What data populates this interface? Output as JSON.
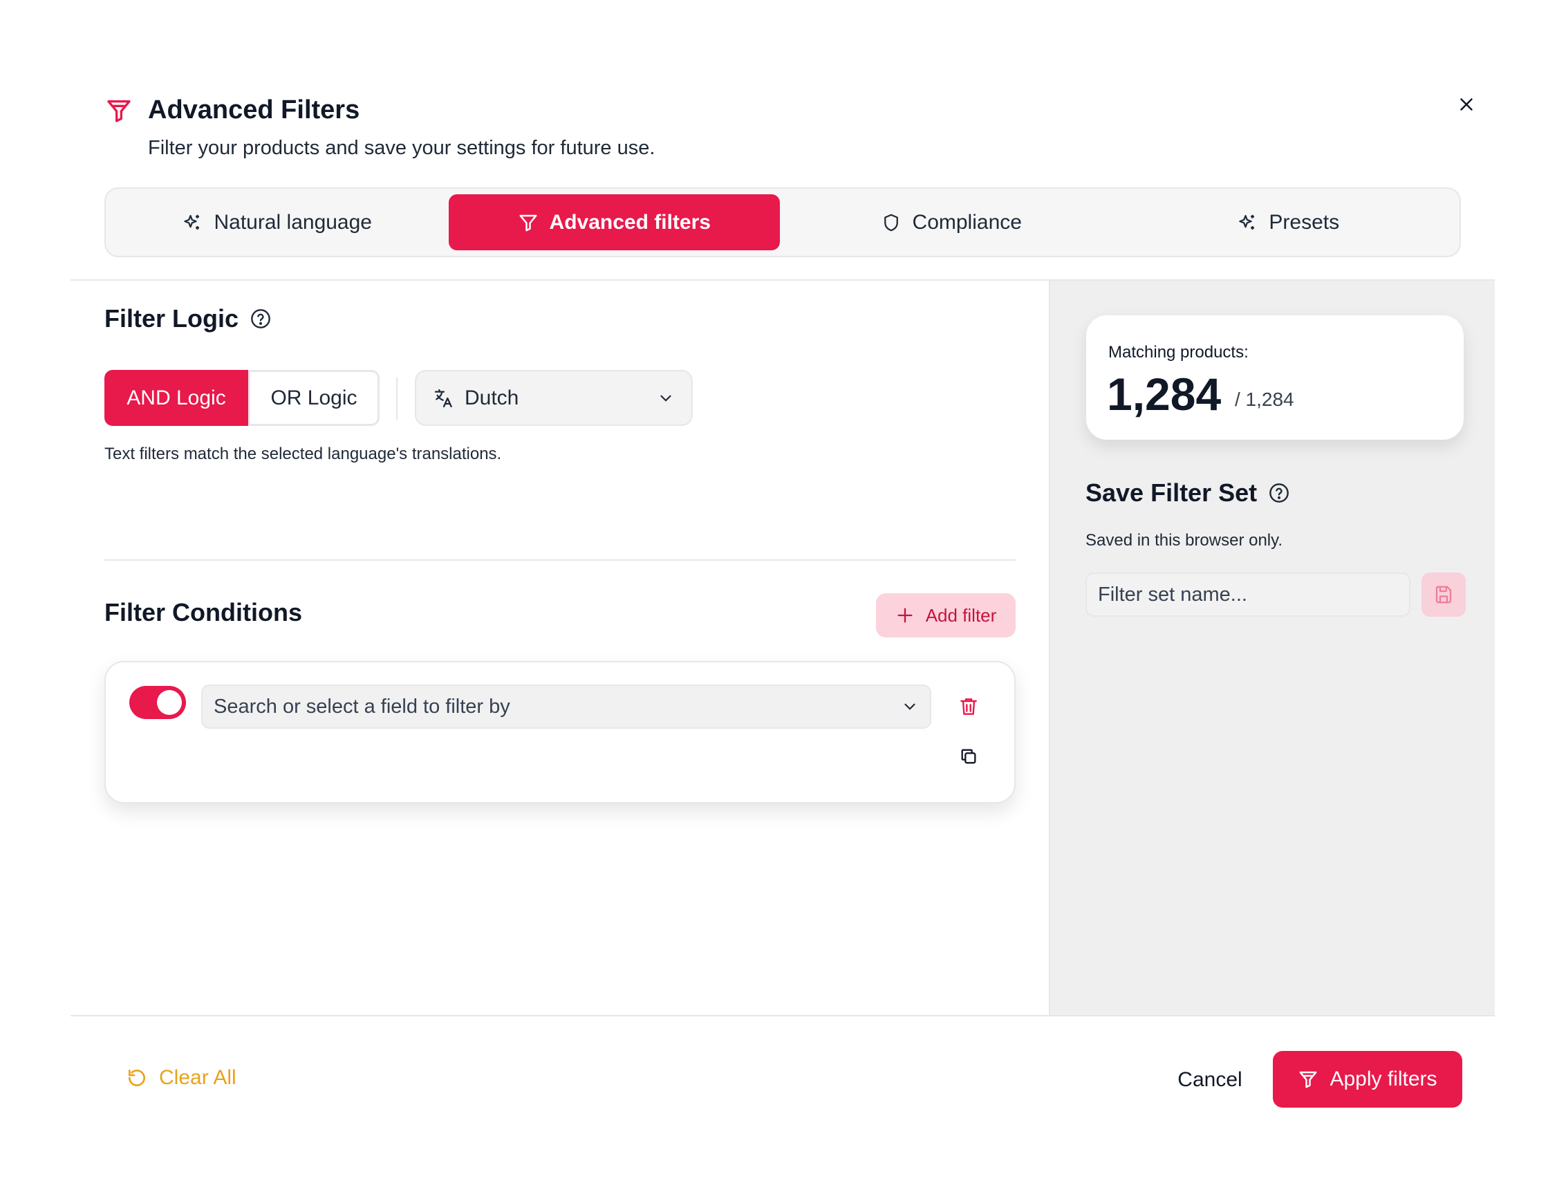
{
  "header": {
    "title": "Advanced Filters",
    "subtitle": "Filter your products and save your settings for future use.",
    "icon": "filter-icon"
  },
  "tabs": [
    {
      "label": "Natural language",
      "icon": "sparkles-icon",
      "active": false
    },
    {
      "label": "Advanced filters",
      "icon": "filter-icon",
      "active": true
    },
    {
      "label": "Compliance",
      "icon": "shield-icon",
      "active": false
    },
    {
      "label": "Presets",
      "icon": "sparkles-icon",
      "active": false
    }
  ],
  "filter_logic": {
    "title": "Filter Logic",
    "and_label": "AND Logic",
    "or_label": "OR Logic",
    "selected": "AND",
    "language": "Dutch",
    "helper": "Text filters match the selected language's translations."
  },
  "conditions": {
    "title": "Filter Conditions",
    "add_label": "Add filter",
    "rows": [
      {
        "enabled": true,
        "field_placeholder": "Search or select a field to filter by"
      }
    ]
  },
  "summary": {
    "label": "Matching products:",
    "count": "1,284",
    "total": "/ 1,284"
  },
  "save_set": {
    "title": "Save Filter Set",
    "note": "Saved in this browser only.",
    "placeholder": "Filter set name..."
  },
  "footer": {
    "clear_label": "Clear All",
    "cancel_label": "Cancel",
    "apply_label": "Apply filters"
  },
  "colors": {
    "accent": "#e8194b",
    "accent_light": "#fcd3dc",
    "warning": "#e9a21a",
    "panel_bg": "#efefef"
  }
}
